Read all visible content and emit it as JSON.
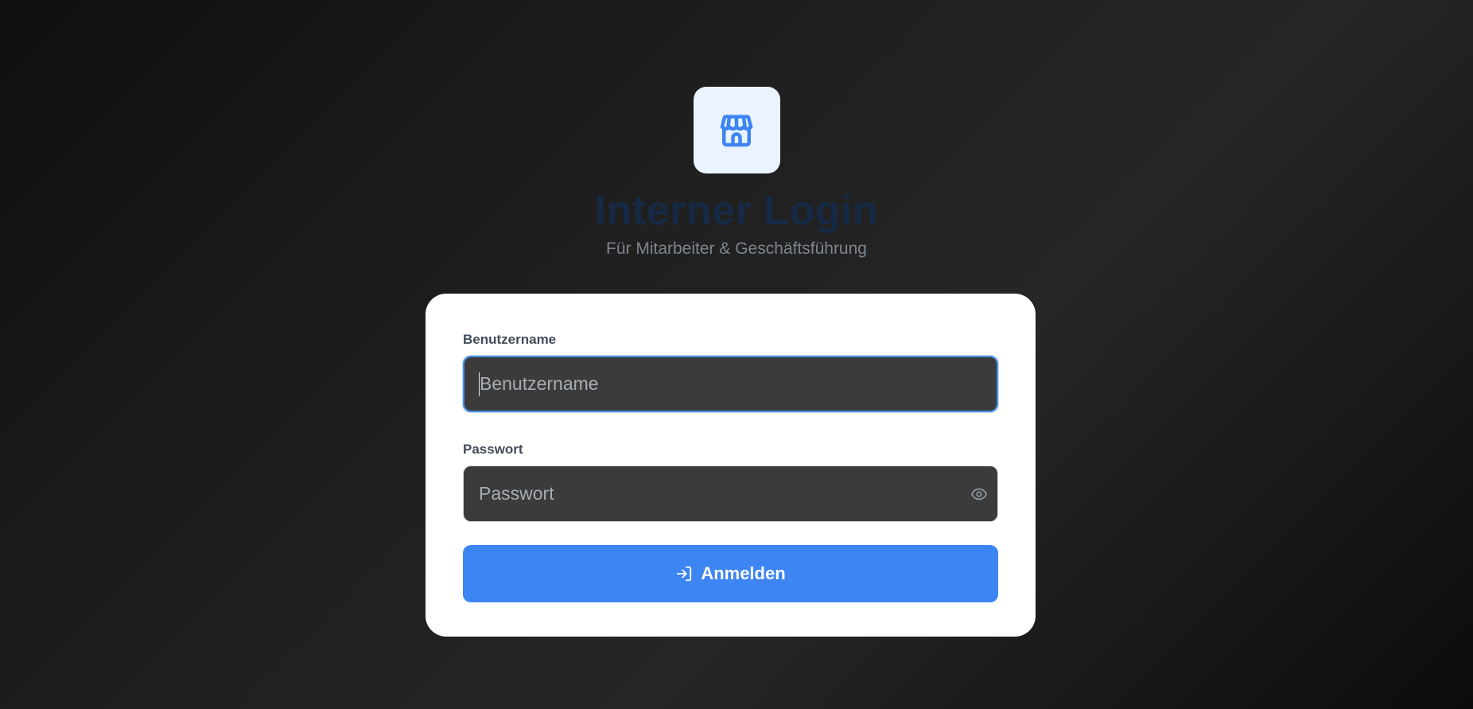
{
  "brand": {
    "icon": "store-icon",
    "title": "Interner Login",
    "subtitle": "Für Mitarbeiter & Geschäftsführung"
  },
  "form": {
    "username": {
      "label": "Benutzername",
      "placeholder": "Benutzername",
      "value": ""
    },
    "password": {
      "label": "Passwort",
      "placeholder": "Passwort",
      "value": "",
      "toggle_icon": "eye-icon"
    },
    "submit": {
      "label": "Anmelden",
      "icon": "log-in-icon"
    }
  },
  "colors": {
    "accent": "#3d85f2",
    "title": "#172a45",
    "input_background": "#3b3b3b",
    "card": "#ffffff"
  }
}
